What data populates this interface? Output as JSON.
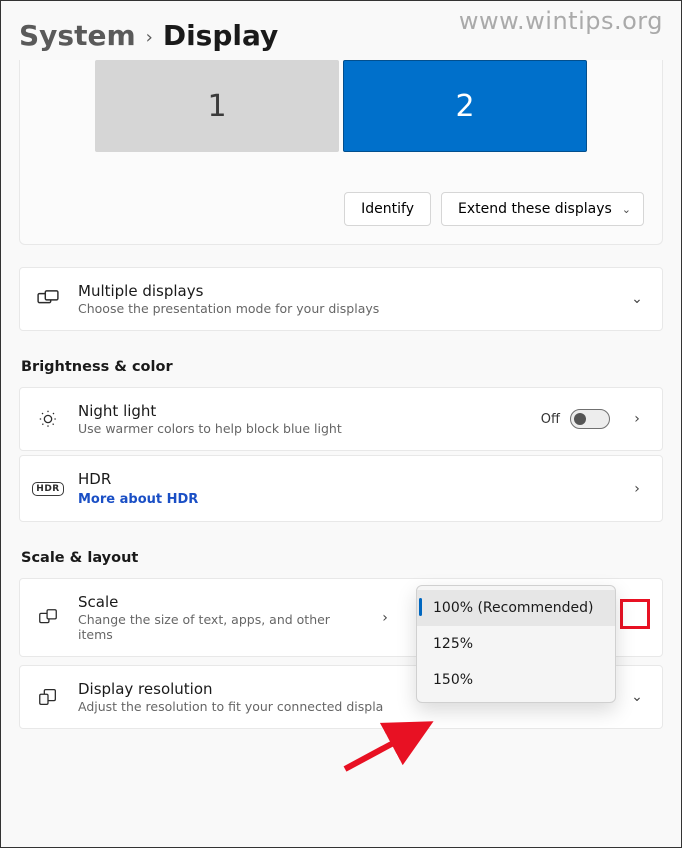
{
  "watermark": "www.wintips.org",
  "breadcrumb": {
    "parent": "System",
    "current": "Display"
  },
  "monitors": {
    "one": "1",
    "two": "2"
  },
  "arrange_actions": {
    "identify": "Identify",
    "extend": "Extend these displays"
  },
  "multiple_displays": {
    "title": "Multiple displays",
    "sub": "Choose the presentation mode for your displays"
  },
  "section_brightness": "Brightness & color",
  "night_light": {
    "title": "Night light",
    "sub": "Use warmer colors to help block blue light",
    "state": "Off"
  },
  "hdr": {
    "title": "HDR",
    "link": "More about HDR",
    "badge": "HDR"
  },
  "section_scale": "Scale & layout",
  "scale": {
    "title": "Scale",
    "sub": "Change the size of text, apps, and other items",
    "options": {
      "opt1": "100% (Recommended)",
      "opt2": "125%",
      "opt3": "150%"
    }
  },
  "resolution": {
    "title": "Display resolution",
    "sub": "Adjust the resolution to fit your connected displa"
  }
}
